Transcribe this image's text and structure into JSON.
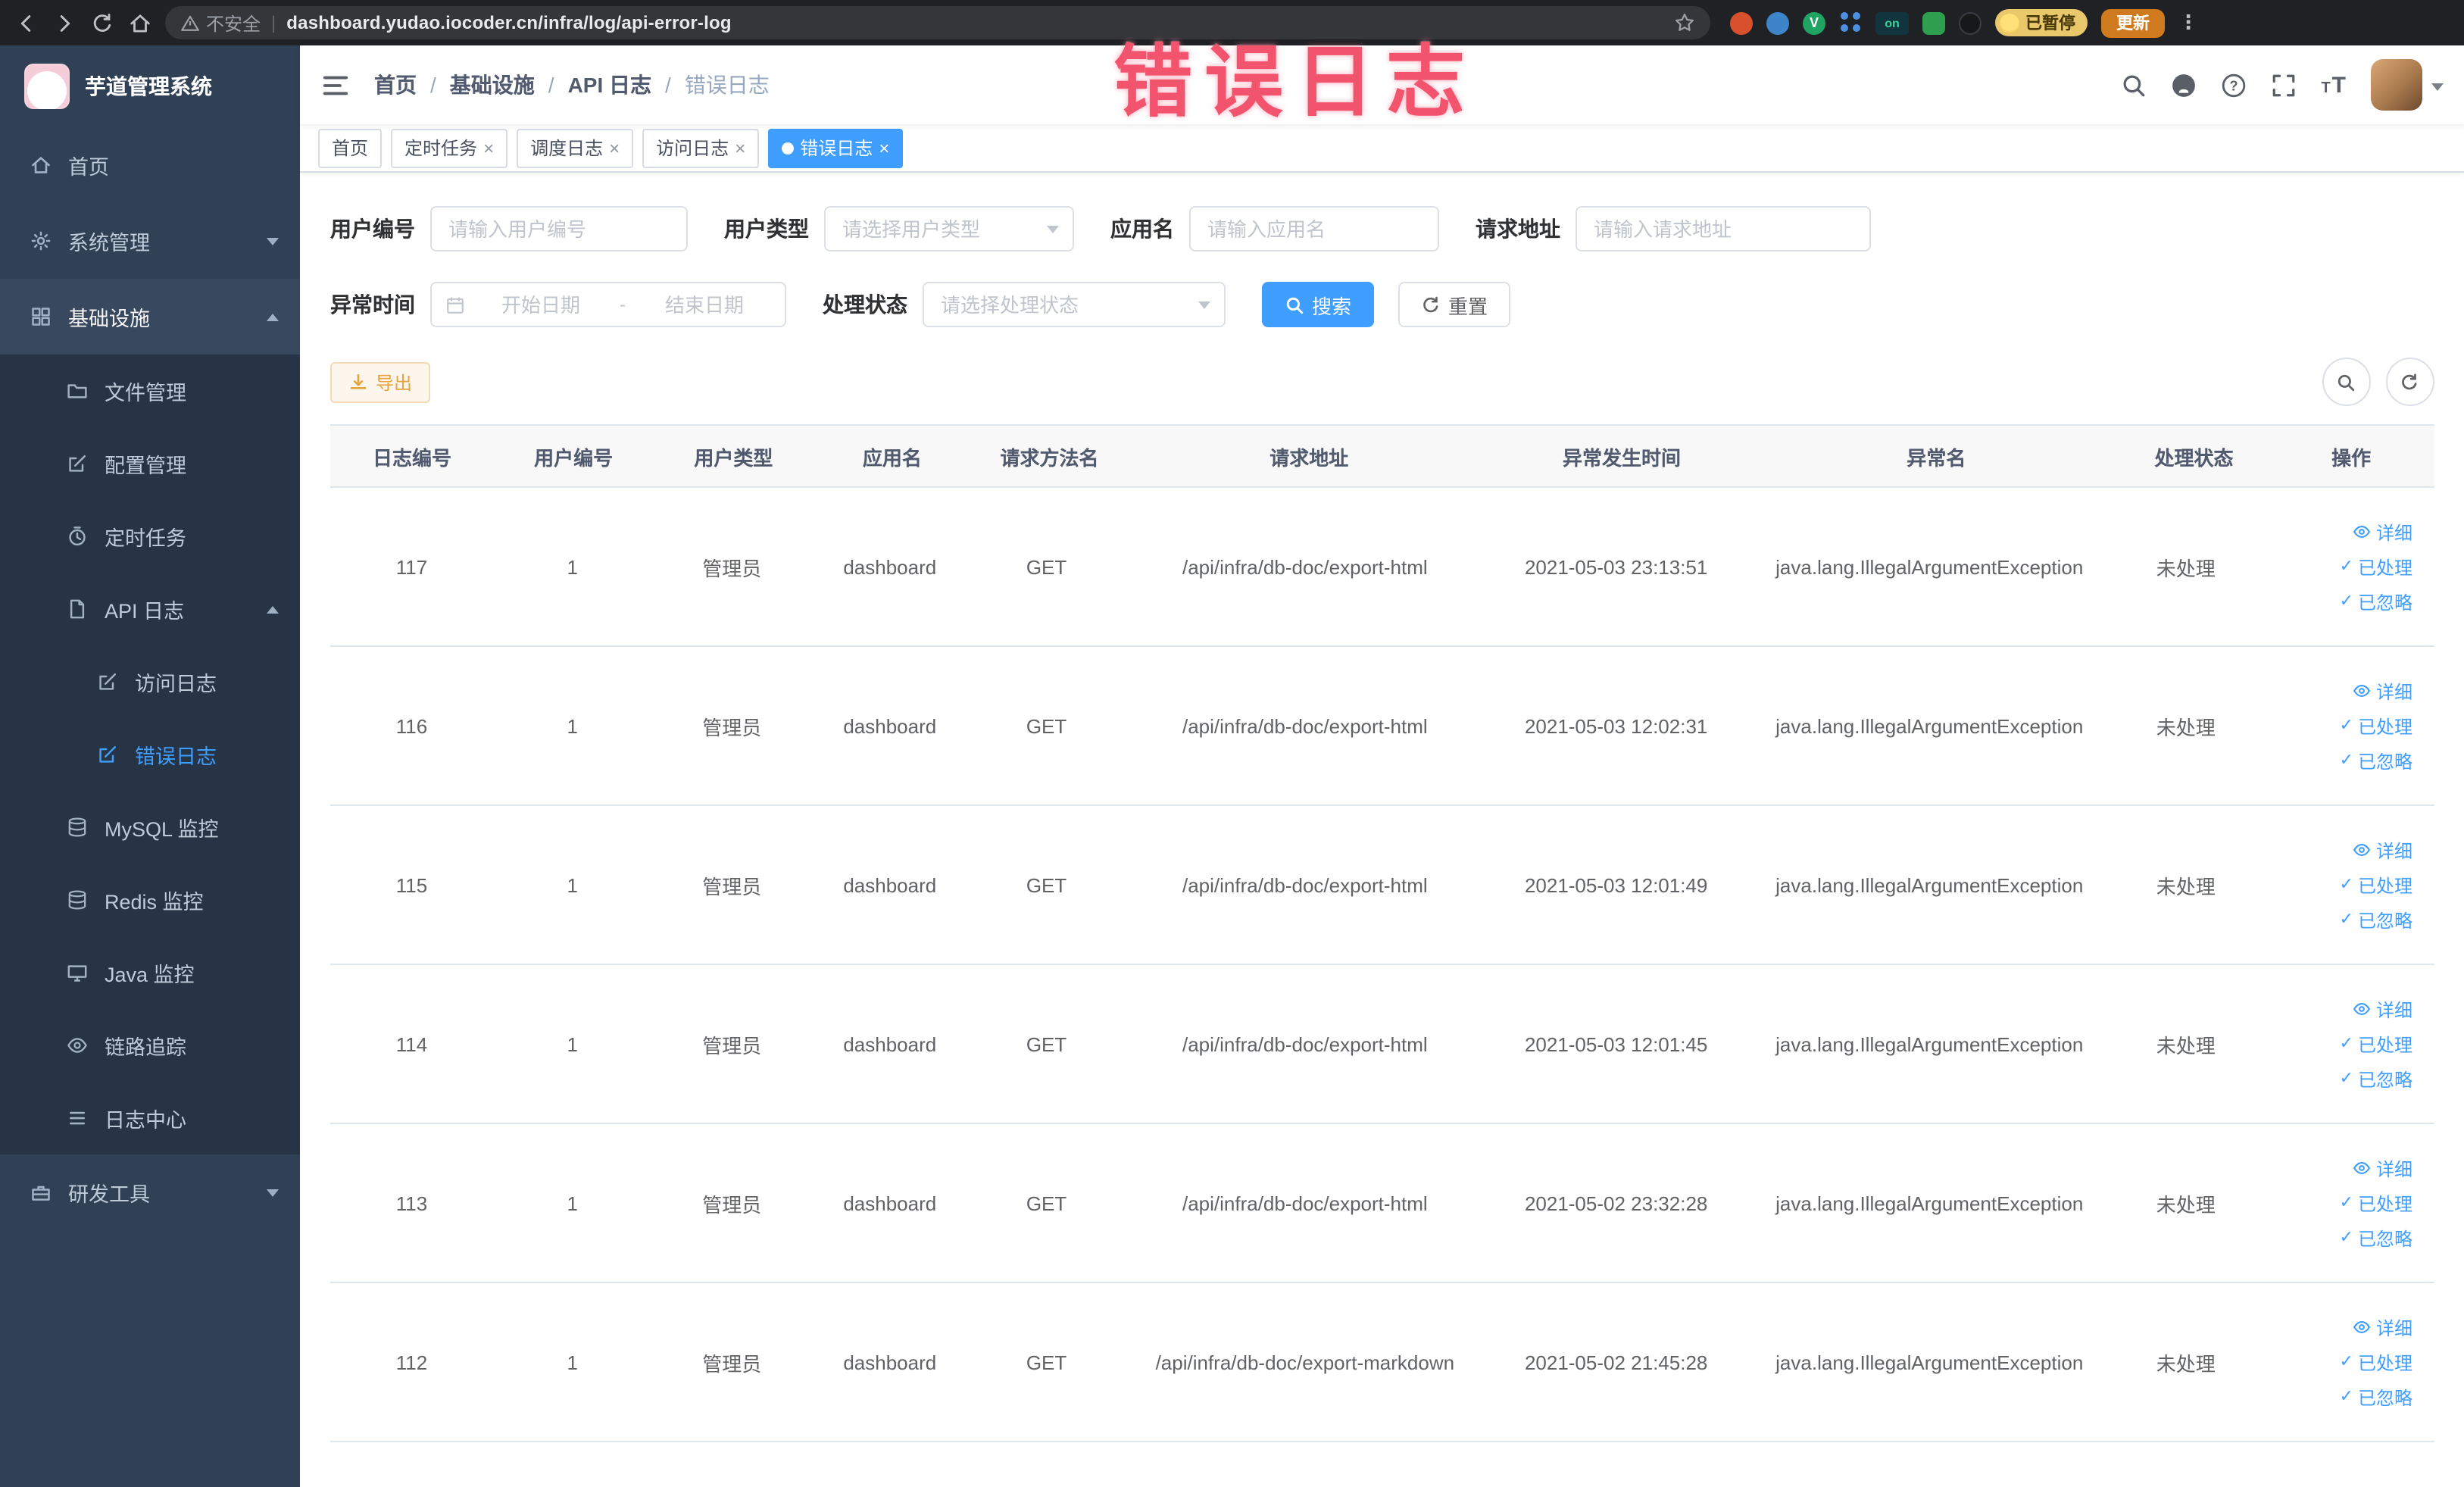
{
  "colors": {
    "primary": "#409EFF",
    "warning": "#E6A23C",
    "sidebar_bg": "#304156",
    "annotation_pink": "#F2536D"
  },
  "browser": {
    "security_label": "不安全",
    "url": "dashboard.yudao.iocoder.cn/infra/log/api-error-log",
    "extension_on_badge": "on",
    "paused_badge": "已暂停",
    "update_button": "更新"
  },
  "annotation": {
    "text": "错误日志"
  },
  "sidebar": {
    "logo_title": "芋道管理系统",
    "home": "首页",
    "system_mgmt": "系统管理",
    "infrastructure": "基础设施",
    "file_mgmt": "文件管理",
    "config_mgmt": "配置管理",
    "scheduled_tasks": "定时任务",
    "api_log": "API 日志",
    "access_log": "访问日志",
    "error_log": "错误日志",
    "mysql_monitor": "MySQL 监控",
    "redis_monitor": "Redis 监控",
    "java_monitor": "Java 监控",
    "trace": "链路追踪",
    "log_center": "日志中心",
    "dev_tools": "研发工具"
  },
  "navbar": {
    "breadcrumb": [
      "首页",
      "基础设施",
      "API 日志",
      "错误日志"
    ]
  },
  "tags": {
    "home": "首页",
    "scheduled_tasks": "定时任务",
    "schedule_log": "调度日志",
    "access_log": "访问日志",
    "error_log": "错误日志"
  },
  "filters": {
    "user_id_label": "用户编号",
    "user_id_placeholder": "请输入用户编号",
    "user_type_label": "用户类型",
    "user_type_placeholder": "请选择用户类型",
    "app_name_label": "应用名",
    "app_name_placeholder": "请输入应用名",
    "request_url_label": "请求地址",
    "request_url_placeholder": "请输入请求地址",
    "exception_time_label": "异常时间",
    "start_date_placeholder": "开始日期",
    "date_separator": "-",
    "end_date_placeholder": "结束日期",
    "process_status_label": "处理状态",
    "process_status_placeholder": "请选择处理状态",
    "search_button": "搜索",
    "reset_button": "重置"
  },
  "toolbar": {
    "export_button": "导出"
  },
  "table": {
    "columns": [
      "日志编号",
      "用户编号",
      "用户类型",
      "应用名",
      "请求方法名",
      "请求地址",
      "异常发生时间",
      "异常名",
      "处理状态",
      "操作"
    ],
    "actions": {
      "detail": "详细",
      "processed": "已处理",
      "ignored": "已忽略"
    },
    "rows": [
      {
        "id": "117",
        "user_id": "1",
        "user_type": "管理员",
        "app": "dashboard",
        "method": "GET",
        "url": "/api/infra/db-doc/export-html",
        "time": "2021-05-03 23:13:51",
        "exception": "java.lang.IllegalArgumentException",
        "status": "未处理"
      },
      {
        "id": "116",
        "user_id": "1",
        "user_type": "管理员",
        "app": "dashboard",
        "method": "GET",
        "url": "/api/infra/db-doc/export-html",
        "time": "2021-05-03 12:02:31",
        "exception": "java.lang.IllegalArgumentException",
        "status": "未处理"
      },
      {
        "id": "115",
        "user_id": "1",
        "user_type": "管理员",
        "app": "dashboard",
        "method": "GET",
        "url": "/api/infra/db-doc/export-html",
        "time": "2021-05-03 12:01:49",
        "exception": "java.lang.IllegalArgumentException",
        "status": "未处理"
      },
      {
        "id": "114",
        "user_id": "1",
        "user_type": "管理员",
        "app": "dashboard",
        "method": "GET",
        "url": "/api/infra/db-doc/export-html",
        "time": "2021-05-03 12:01:45",
        "exception": "java.lang.IllegalArgumentException",
        "status": "未处理"
      },
      {
        "id": "113",
        "user_id": "1",
        "user_type": "管理员",
        "app": "dashboard",
        "method": "GET",
        "url": "/api/infra/db-doc/export-html",
        "time": "2021-05-02 23:32:28",
        "exception": "java.lang.IllegalArgumentException",
        "status": "未处理"
      },
      {
        "id": "112",
        "user_id": "1",
        "user_type": "管理员",
        "app": "dashboard",
        "method": "GET",
        "url": "/api/infra/db-doc/export-markdown",
        "time": "2021-05-02 21:45:28",
        "exception": "java.lang.IllegalArgumentException",
        "status": "未处理"
      }
    ]
  }
}
